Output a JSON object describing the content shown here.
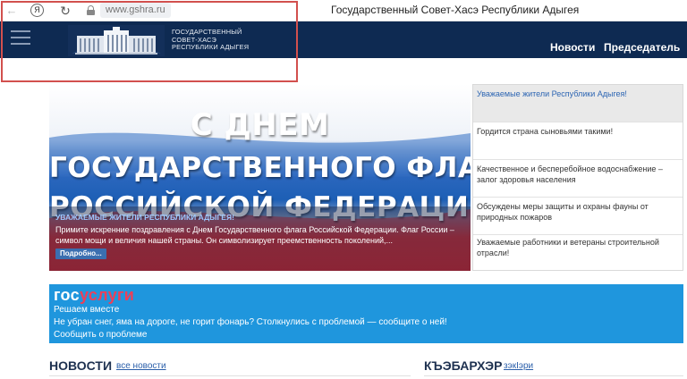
{
  "browser": {
    "url": "www.gshra.ru",
    "tab_title": "Государственный Совет-Хасэ Республики Адыгея",
    "yandex_glyph": "Я"
  },
  "header": {
    "logo_lines": [
      "ГОСУДАРСТВЕННЫЙ",
      "СОВЕТ-ХАСЭ",
      "РЕСПУБЛИКИ АДЫГЕЯ"
    ],
    "nav": [
      "Новости",
      "Председатель"
    ]
  },
  "banner": {
    "headline": [
      "С ДНЕМ",
      "ГОСУДАРСТВЕННОГО ФЛАГА",
      "РОССИЙСКОЙ ФЕДЕРАЦИИ"
    ],
    "overlay_title": "УВАЖАЕМЫЕ ЖИТЕЛИ РЕСПУБЛИКИ АДЫГЕЯ!",
    "overlay_text": "Примите искренние поздравления с Днем Государственного флага Российской Федерации.  Флаг России – символ мощи и величия нашей страны. Он символизирует преемственность поколений,...",
    "more_label": "Подробно...",
    "colors": {
      "white": "#ffffff",
      "blue": "#1d5fb5",
      "red": "#d5242b"
    }
  },
  "side_news": [
    "Уважаемые жители Республики Адыгея!",
    "Гордится страна сыновьями такими!",
    "Качественное и бесперебойное водоснабжение – залог здоровья населения",
    "Обсуждены меры защиты и охраны фауны от природных пожаров",
    "Уважаемые работники и ветераны строительной отрасли!"
  ],
  "gosuslugi": {
    "logo_part1": "гос",
    "logo_part2": "услуги",
    "line1": "Решаем вместе",
    "line2": "Не убран снег, яма на дороге, не горит фонарь? Столкнулись с проблемой — сообщите о ней!",
    "line3": "Сообщить о проблеме"
  },
  "sections": {
    "news_title": "НОВОСТИ",
    "news_link": "все новости",
    "ady_title": "КЪЭБАРХЭР",
    "ady_link": "зэкIэри"
  },
  "accent_colors": {
    "header_bg": "#0e2a52",
    "gos_bg": "#1f96dd",
    "highlight": "#d2504e"
  }
}
